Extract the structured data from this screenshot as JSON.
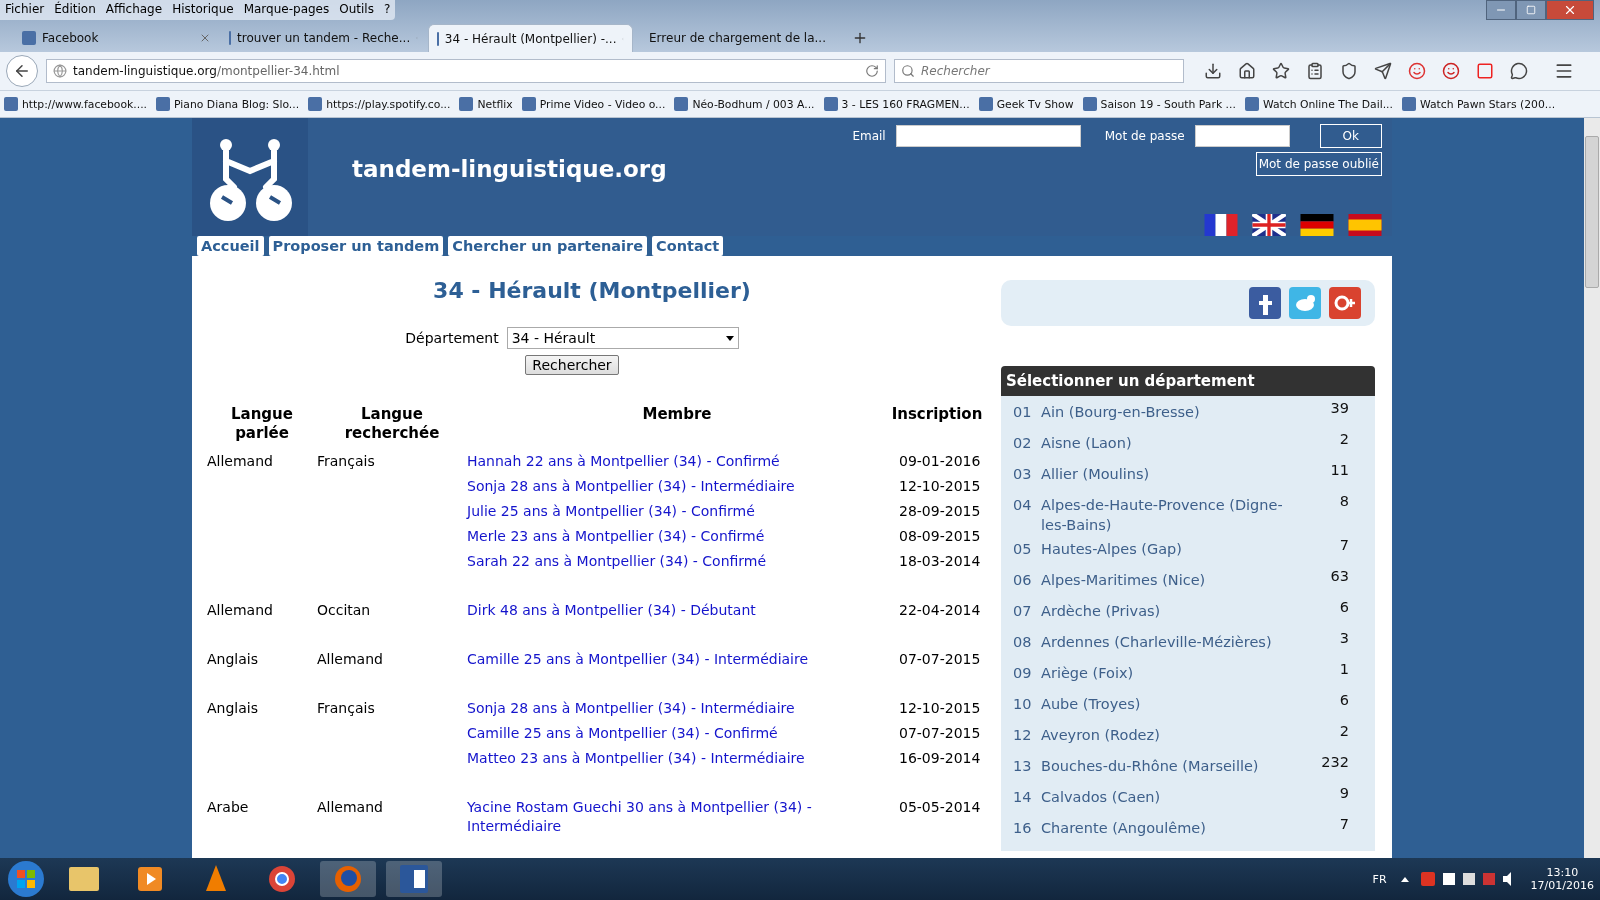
{
  "browser": {
    "menu": [
      "Fichier",
      "Édition",
      "Affichage",
      "Historique",
      "Marque-pages",
      "Outils",
      "?"
    ],
    "tabs": [
      {
        "title": "Facebook",
        "selected": false
      },
      {
        "title": "trouver un tandem - Reche...",
        "selected": false
      },
      {
        "title": "34 - Hérault (Montpellier) -...",
        "selected": true
      },
      {
        "title": "Erreur de chargement de la...",
        "selected": false
      }
    ],
    "url": {
      "host": "tandem-linguistique.org",
      "path": "/montpellier-34.html"
    },
    "search_placeholder": "Rechercher",
    "bookmarks": [
      "http://www.facebook....",
      "Piano Diana Blog: Slo...",
      "https://play.spotify.co...",
      "Netflix",
      "Prime Video - Video o...",
      "Néo-Bodhum / 003 A...",
      "3 - LES 160 FRAGMEN...",
      "Geek Tv Show",
      "Saison 19 - South Park ...",
      "Watch Online The Dail...",
      "Watch Pawn Stars (200..."
    ]
  },
  "site": {
    "name": "tandem-linguistique.org",
    "login": {
      "email_label": "Email",
      "password_label": "Mot de passe",
      "ok": "Ok",
      "forgot": "Mot de passe oublié"
    },
    "nav": [
      "Accueil",
      "Proposer un tandem",
      "Chercher un partenaire",
      "Contact"
    ],
    "heading": "34 - Hérault (Montpellier)",
    "department": {
      "label": "Département",
      "value": "34 - Hérault"
    },
    "search_button": "Rechercher",
    "table": {
      "columns": [
        "Langue parlée",
        "Langue recherchée",
        "Membre",
        "Inscription"
      ],
      "groups": [
        {
          "spoken": "Allemand",
          "wanted": "Français",
          "members": [
            {
              "text": "Hannah 22 ans à Montpellier (34) - Confirmé",
              "date": "09-01-2016"
            },
            {
              "text": "Sonja 28 ans à Montpellier (34) - Intermédiaire",
              "date": "12-10-2015"
            },
            {
              "text": "Julie 25 ans à Montpellier (34) - Confirmé",
              "date": "28-09-2015"
            },
            {
              "text": "Merle 23 ans à Montpellier (34) - Confirmé",
              "date": "08-09-2015"
            },
            {
              "text": "Sarah 22 ans à Montpellier (34) - Confirmé",
              "date": "18-03-2014"
            }
          ]
        },
        {
          "spoken": "Allemand",
          "wanted": "Occitan",
          "members": [
            {
              "text": "Dirk 48 ans à Montpellier (34) - Débutant",
              "date": "22-04-2014"
            }
          ]
        },
        {
          "spoken": "Anglais",
          "wanted": "Allemand",
          "members": [
            {
              "text": "Camille 25 ans à Montpellier (34) - Intermédiaire",
              "date": "07-07-2015"
            }
          ]
        },
        {
          "spoken": "Anglais",
          "wanted": "Français",
          "members": [
            {
              "text": "Sonja 28 ans à Montpellier (34) - Intermédiaire",
              "date": "12-10-2015"
            },
            {
              "text": "Camille 25 ans à Montpellier (34) - Confirmé",
              "date": "07-07-2015"
            },
            {
              "text": "Matteo 23 ans à Montpellier (34) - Intermédiaire",
              "date": "16-09-2014"
            }
          ]
        },
        {
          "spoken": "Arabe",
          "wanted": "Allemand",
          "members": [
            {
              "text": "Yacine Rostam Guechi 30 ans à Montpellier (34) - Intermédiaire",
              "date": "05-05-2014"
            }
          ]
        }
      ]
    },
    "sidebar": {
      "title": "Sélectionner un département",
      "departments": [
        {
          "code": "01",
          "name": "Ain (Bourg-en-Bresse)",
          "count": "39"
        },
        {
          "code": "02",
          "name": "Aisne (Laon)",
          "count": "2"
        },
        {
          "code": "03",
          "name": "Allier (Moulins)",
          "count": "11"
        },
        {
          "code": "04",
          "name": "Alpes-de-Haute-Provence (Digne-les-Bains)",
          "count": "8"
        },
        {
          "code": "05",
          "name": "Hautes-Alpes (Gap)",
          "count": "7"
        },
        {
          "code": "06",
          "name": "Alpes-Maritimes (Nice)",
          "count": "63"
        },
        {
          "code": "07",
          "name": "Ardèche (Privas)",
          "count": "6"
        },
        {
          "code": "08",
          "name": "Ardennes (Charleville-Mézières)",
          "count": "3"
        },
        {
          "code": "09",
          "name": "Ariège (Foix)",
          "count": "1"
        },
        {
          "code": "10",
          "name": "Aube (Troyes)",
          "count": "6"
        },
        {
          "code": "12",
          "name": "Aveyron (Rodez)",
          "count": "2"
        },
        {
          "code": "13",
          "name": "Bouches-du-Rhône (Marseille)",
          "count": "232"
        },
        {
          "code": "14",
          "name": "Calvados (Caen)",
          "count": "9"
        },
        {
          "code": "16",
          "name": "Charente (Angoulême)",
          "count": "7"
        }
      ]
    }
  },
  "taskbar": {
    "language": "FR",
    "time": "13:10",
    "date": "17/01/2016"
  }
}
